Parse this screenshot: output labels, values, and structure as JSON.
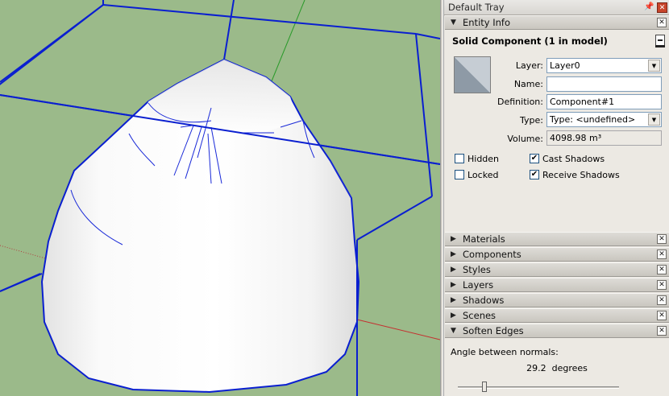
{
  "tray": {
    "title": "Default Tray",
    "pin_icon": "pin-icon",
    "close_icon": "close-icon"
  },
  "entity_info": {
    "panel_title": "Entity Info",
    "entity_title": "Solid Component (1 in model)",
    "layer_label": "Layer:",
    "layer_value": "Layer0",
    "name_label": "Name:",
    "name_value": "",
    "definition_label": "Definition:",
    "definition_value": "Component#1",
    "type_label": "Type:",
    "type_value": "Type: <undefined>",
    "volume_label": "Volume:",
    "volume_value": "4098.98 m³",
    "hidden_label": "Hidden",
    "hidden_checked": false,
    "locked_label": "Locked",
    "locked_checked": false,
    "cast_shadows_label": "Cast Shadows",
    "cast_shadows_checked": true,
    "receive_shadows_label": "Receive Shadows",
    "receive_shadows_checked": true
  },
  "collapsed_panels": [
    {
      "label": "Materials"
    },
    {
      "label": "Components"
    },
    {
      "label": "Styles"
    },
    {
      "label": "Layers"
    },
    {
      "label": "Shadows"
    },
    {
      "label": "Scenes"
    }
  ],
  "soften_edges": {
    "panel_title": "Soften Edges",
    "angle_label": "Angle between normals:",
    "angle_value": "29.2  degrees",
    "slider_fraction": 0.17
  },
  "colors": {
    "viewport_bg": "#9bba8a",
    "bounding_box": "#0a1fd0",
    "green_axis": "#2a9a2a",
    "red_axis": "#c43030"
  }
}
